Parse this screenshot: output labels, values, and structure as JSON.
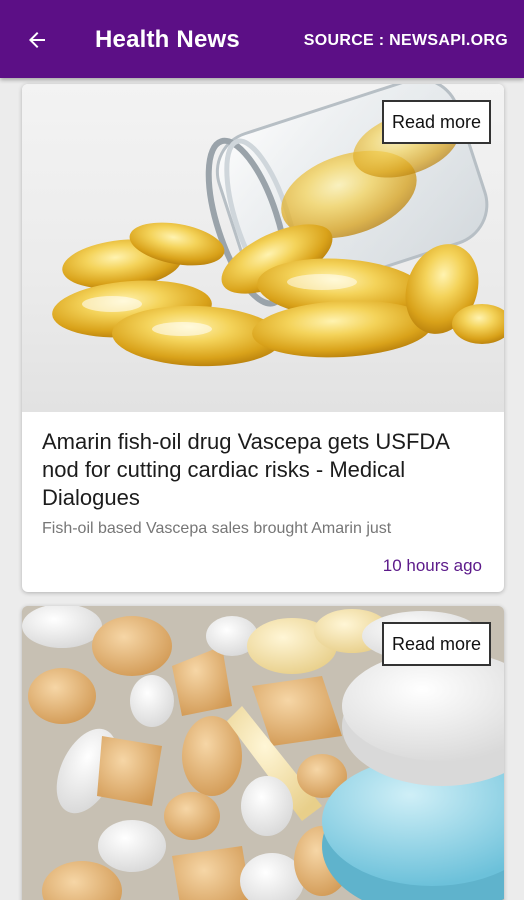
{
  "appbar": {
    "back_icon": "arrow-left-icon",
    "title": "Health News",
    "source": "SOURCE : NEWSAPI.ORG",
    "color": "#5c0f86"
  },
  "articles": [
    {
      "read_more": "Read more",
      "headline": "Amarin fish-oil drug Vascepa gets USFDA nod for cutting cardiac risks - Medical Dialogues",
      "snippet": "Fish-oil based Vascepa sales brought Amarin just",
      "time": "10 hours ago"
    },
    {
      "read_more": "Read more"
    }
  ],
  "accent_color": "#5c1a8a"
}
